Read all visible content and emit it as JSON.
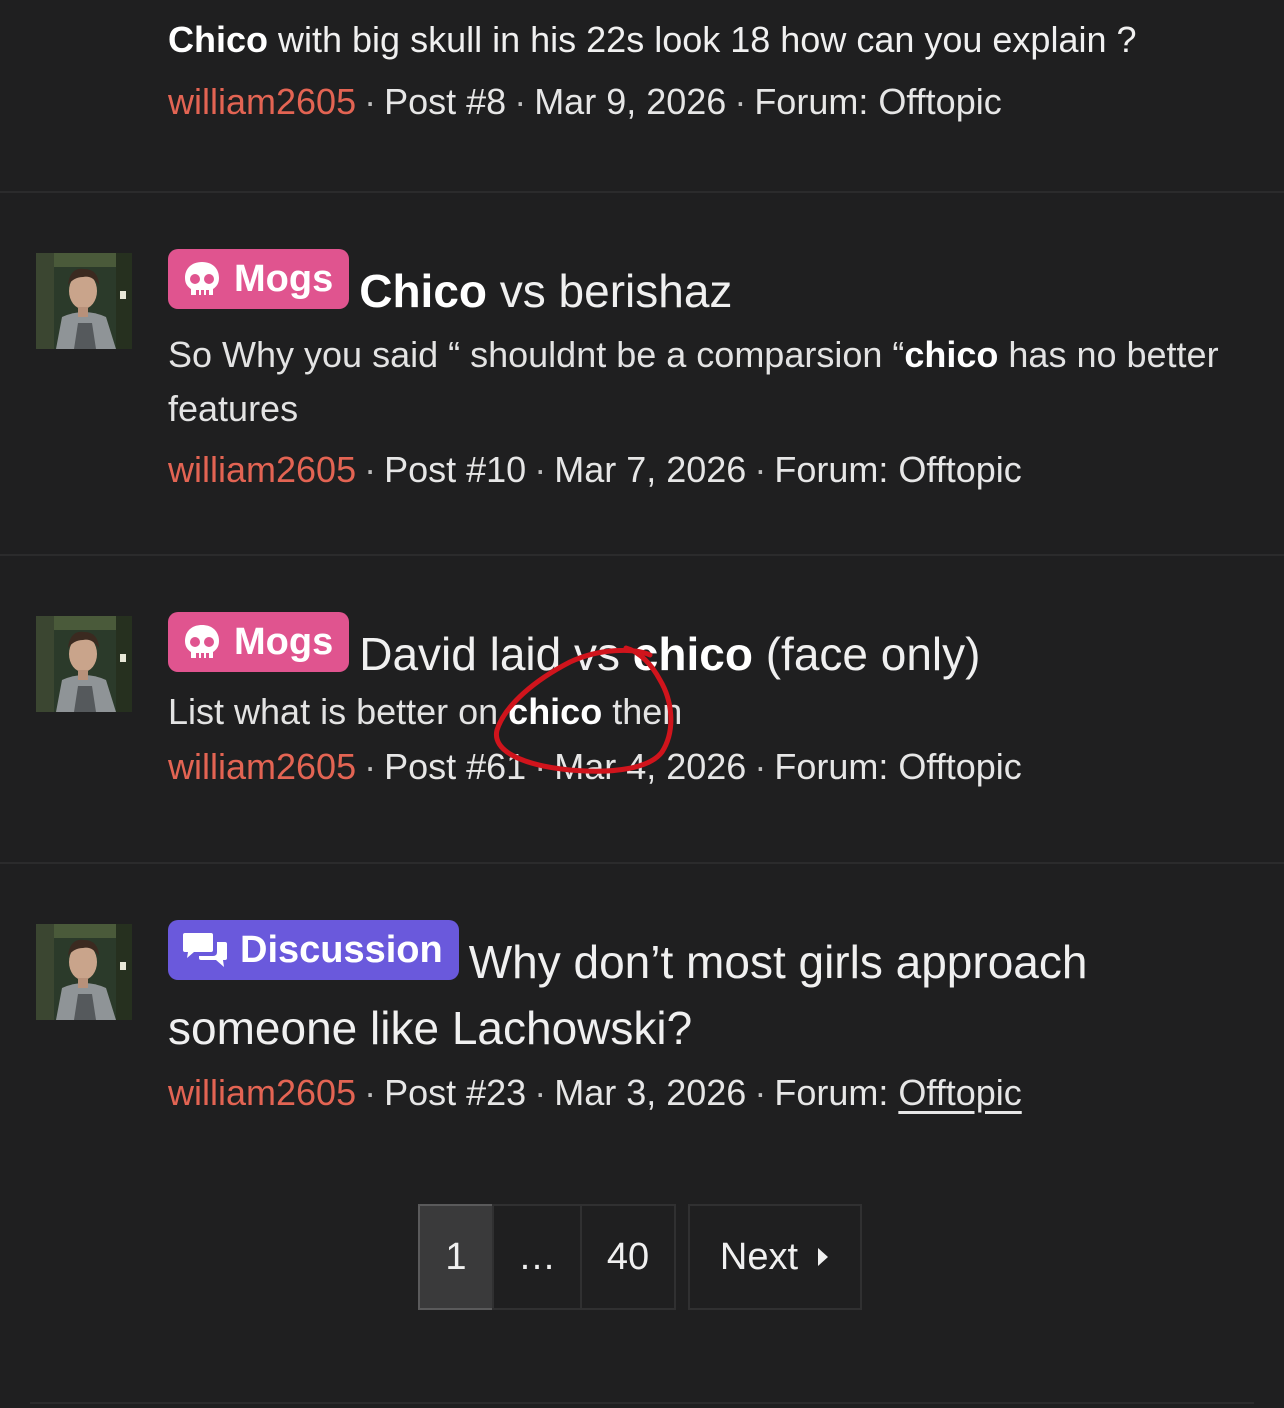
{
  "results": [
    {
      "title_bold": "Chico",
      "title_rest": " with big skull in his 22s look 18 how can you explain ?",
      "user": "william2605",
      "post": "Post #8",
      "date": "Mar 9, 2026",
      "forum_prefix": "Forum: ",
      "forum": "Offtopic"
    },
    {
      "label": "Mogs",
      "title_bold": "Chico",
      "title_rest": " vs berishaz",
      "snippet_pre": "So Why you said “ shouldnt be a comparsion “",
      "snippet_bold": "chico",
      "snippet_post": " has no better features",
      "user": "william2605",
      "post": "Post #10",
      "date": "Mar 7, 2026",
      "forum_prefix": "Forum: ",
      "forum": "Offtopic"
    },
    {
      "label": "Mogs",
      "title_pre": "David laid vs ",
      "title_bold": "chico",
      "title_rest": " (face only)",
      "snippet_pre": "List what is better on ",
      "snippet_bold": "chico",
      "snippet_post": " then",
      "user": "william2605",
      "post": "Post #61",
      "date": "Mar 4, 2026",
      "forum_prefix": "Forum: ",
      "forum": "Offtopic"
    },
    {
      "label": "Discussion",
      "title_rest": "Why don’t most girls approach someone like Lachowski?",
      "user": "william2605",
      "post": "Post #23",
      "date": "Mar 3, 2026",
      "forum_prefix": "Forum: ",
      "forum": "Offtopic"
    }
  ],
  "meta_separator": "·",
  "pagination": {
    "current": "1",
    "ellipsis": "…",
    "last": "40",
    "next_label": "Next"
  },
  "colors": {
    "background": "#1f1f20",
    "username": "#e36453",
    "mogs_label": "#e0548f",
    "discussion_label": "#6a59dc",
    "annotation_circle": "#d0141c"
  },
  "icons": {
    "mogs": "skull-icon",
    "discussion": "speech-bubbles-icon",
    "next": "caret-right-icon"
  }
}
